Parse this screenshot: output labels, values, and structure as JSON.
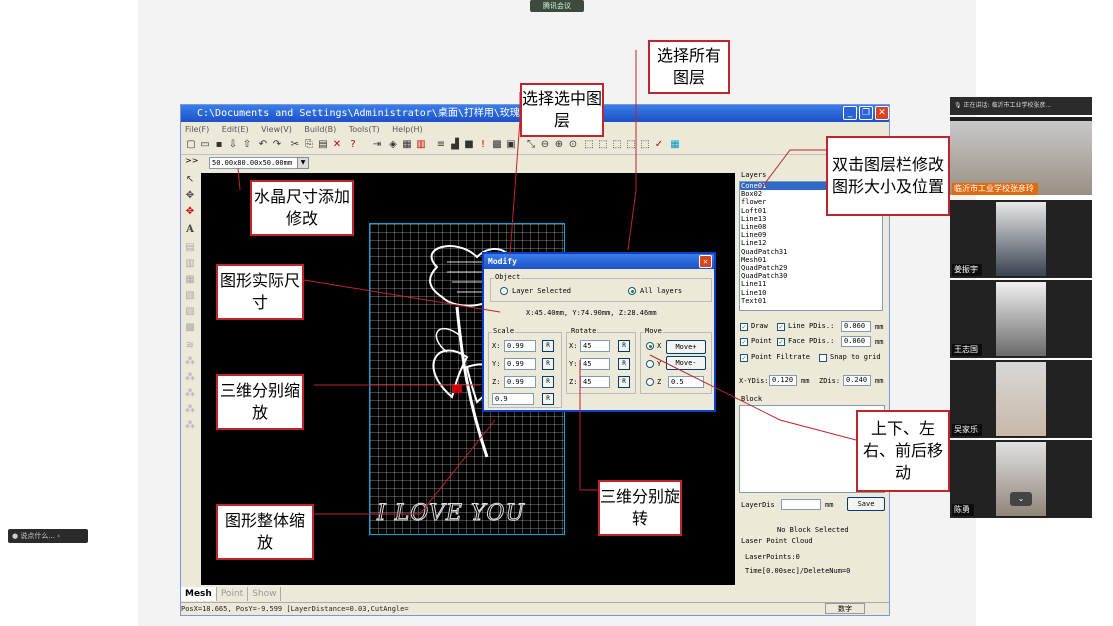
{
  "meeting": {
    "pill_label": "腾讯会议",
    "speaking": "正在讲话: 临沂市工业学校张彦...",
    "left_pill": "说点什么..."
  },
  "app": {
    "title": "C:\\Documents and Settings\\Administrator\\桌面\\打样用\\玫瑰.dxf",
    "menu": [
      "File(F)",
      "Edit(E)",
      "View(V)",
      "Build(B)",
      "Tools(T)",
      "Help(H)"
    ],
    "size_value": "50.00x80.00x50.00mm",
    "canvas_text": "I LOVE YOU",
    "bottom_tabs": [
      "Mesh",
      "Point",
      "Show"
    ],
    "status": "PosX=18.665, PosY=-9.599  [LayerDistance=0.03,CutAngle=",
    "status_right": "数字"
  },
  "layers_panel": {
    "legend": "Layers",
    "items": [
      "Cone01",
      "Box02",
      "flower",
      "Loft01",
      "Line13",
      "Line08",
      "Line09",
      "Line12",
      "QuadPatch31",
      "Mesh01",
      "QuadPatch29",
      "QuadPatch30",
      "Line11",
      "Line10",
      "Text01"
    ],
    "selected_index": 0,
    "draw": "Draw",
    "line": "Line",
    "point": "Point",
    "face": "Face",
    "point_filtrate": "Point Filtrate",
    "snap": "Snap to grid",
    "pdis_label": "PDis.:",
    "pdis1": "0.060",
    "pdis2": "0.060",
    "mm": "mm",
    "xydis_label": "X-YDis:",
    "xydis": "0.120",
    "zdis_label": "ZDis:",
    "zdis": "0.240",
    "block": "Block",
    "layerdis": "LayerDis",
    "save": "Save",
    "no_block": "No Block Selected",
    "cloud": "Laser Point Cloud",
    "laser_points": "LaserPoints:0",
    "time": "Time[0.00sec]/DeleteNum=0"
  },
  "dialog": {
    "title": "Modify",
    "object": "Object",
    "layer_selected": "Layer Selected",
    "all_layers": "All layers",
    "xyz": "X:45.40mm,   Y:74.90mm,   Z:28.46mm",
    "scale": "Scale",
    "rotate": "Rotate",
    "move": "Move",
    "scale_x": "0.99",
    "scale_y": "0.99",
    "scale_z": "0.99",
    "scale_all": "0.9",
    "rot_x": "45",
    "rot_y": "45",
    "rot_z": "45",
    "r": "R",
    "move_plus": "Move+",
    "move_minus": "Move-",
    "move_val": "0.5",
    "x": "X:",
    "y": "Y:",
    "z": "Z:",
    "rx": "X",
    "ry": "Y",
    "rz": "Z"
  },
  "callouts": {
    "select_all": "选择所有图层",
    "select_layer": "选择选中图层",
    "dblclick": "双击图层栏修改图形大小及位置",
    "crystal": "水晶尺寸添加修改",
    "actual": "图形实际尺寸",
    "scale3d": "三维分别缩放",
    "move": "上下、左右、前后移动",
    "rotate3d": "三维分别旋转",
    "scale_all": "图形整体缩放"
  },
  "participants": [
    {
      "name": "临沂市工业学校张彦玲"
    },
    {
      "name": "姜振宇"
    },
    {
      "name": "王志国"
    },
    {
      "name": "吴家乐"
    },
    {
      "name": "陈勇"
    }
  ]
}
